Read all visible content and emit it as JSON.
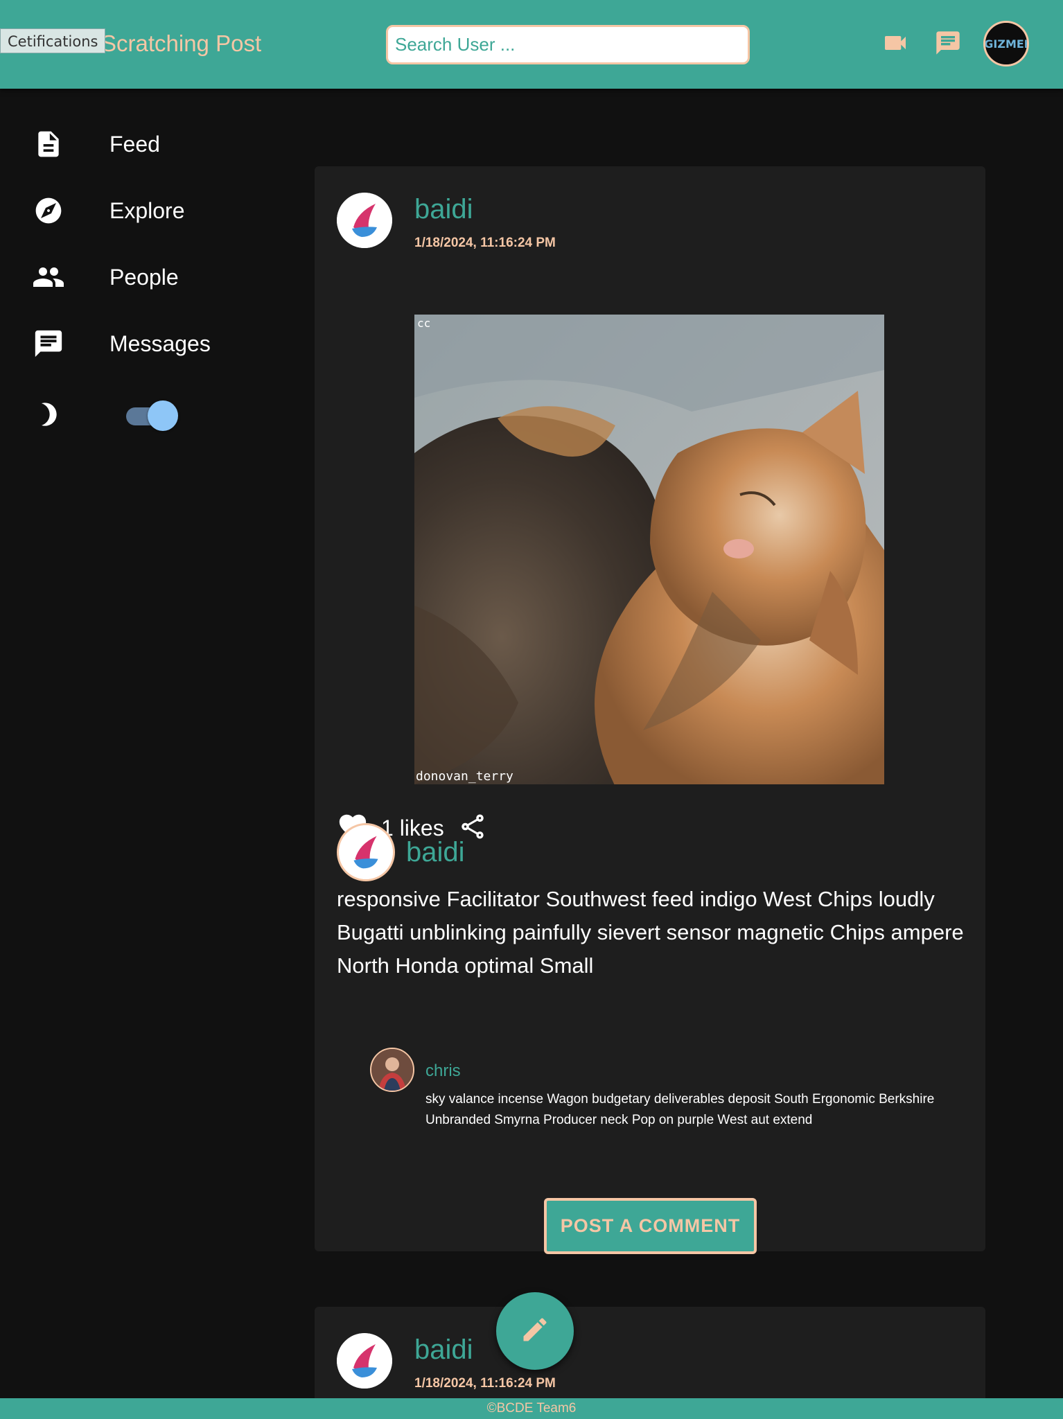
{
  "header": {
    "tooltip": "Cetifications",
    "brand": "Scratching Post",
    "search_placeholder": "Search User ...",
    "icons": [
      "video-icon",
      "chat-icon"
    ],
    "avatar_label": "GIZMEI"
  },
  "sidebar": {
    "items": [
      {
        "label": "Feed",
        "icon": "document-icon"
      },
      {
        "label": "Explore",
        "icon": "compass-icon"
      },
      {
        "label": "People",
        "icon": "people-icon"
      },
      {
        "label": "Messages",
        "icon": "message-icon"
      }
    ],
    "dark_mode_icon": "moon-icon",
    "dark_mode_on": true
  },
  "posts": [
    {
      "author": "baidi",
      "date": "1/18/2024, 11:16:24 PM",
      "image_caption_tl": "cc",
      "image_caption_bl": "donovan_terry",
      "likes": "1 likes",
      "caption_author": "baidi",
      "caption": "responsive Facilitator Southwest feed indigo West Chips loudly Bugatti unblinking painfully sievert sensor magnetic Chips ampere North Honda optimal Small",
      "comments": [
        {
          "user": "chris",
          "text": "sky valance incense Wagon budgetary deliverables deposit South Ergonomic Berkshire Unbranded Smyrna Producer neck Pop on purple West aut extend"
        }
      ],
      "post_comment_label": "POST A COMMENT"
    },
    {
      "author": "baidi",
      "date": "1/18/2024, 11:16:24 PM"
    }
  ],
  "footer": "©BCDE Team6",
  "colors": {
    "accent": "#3ea796",
    "peach": "#f5c6a5",
    "card": "#1e1e1e",
    "bg": "#111111"
  }
}
